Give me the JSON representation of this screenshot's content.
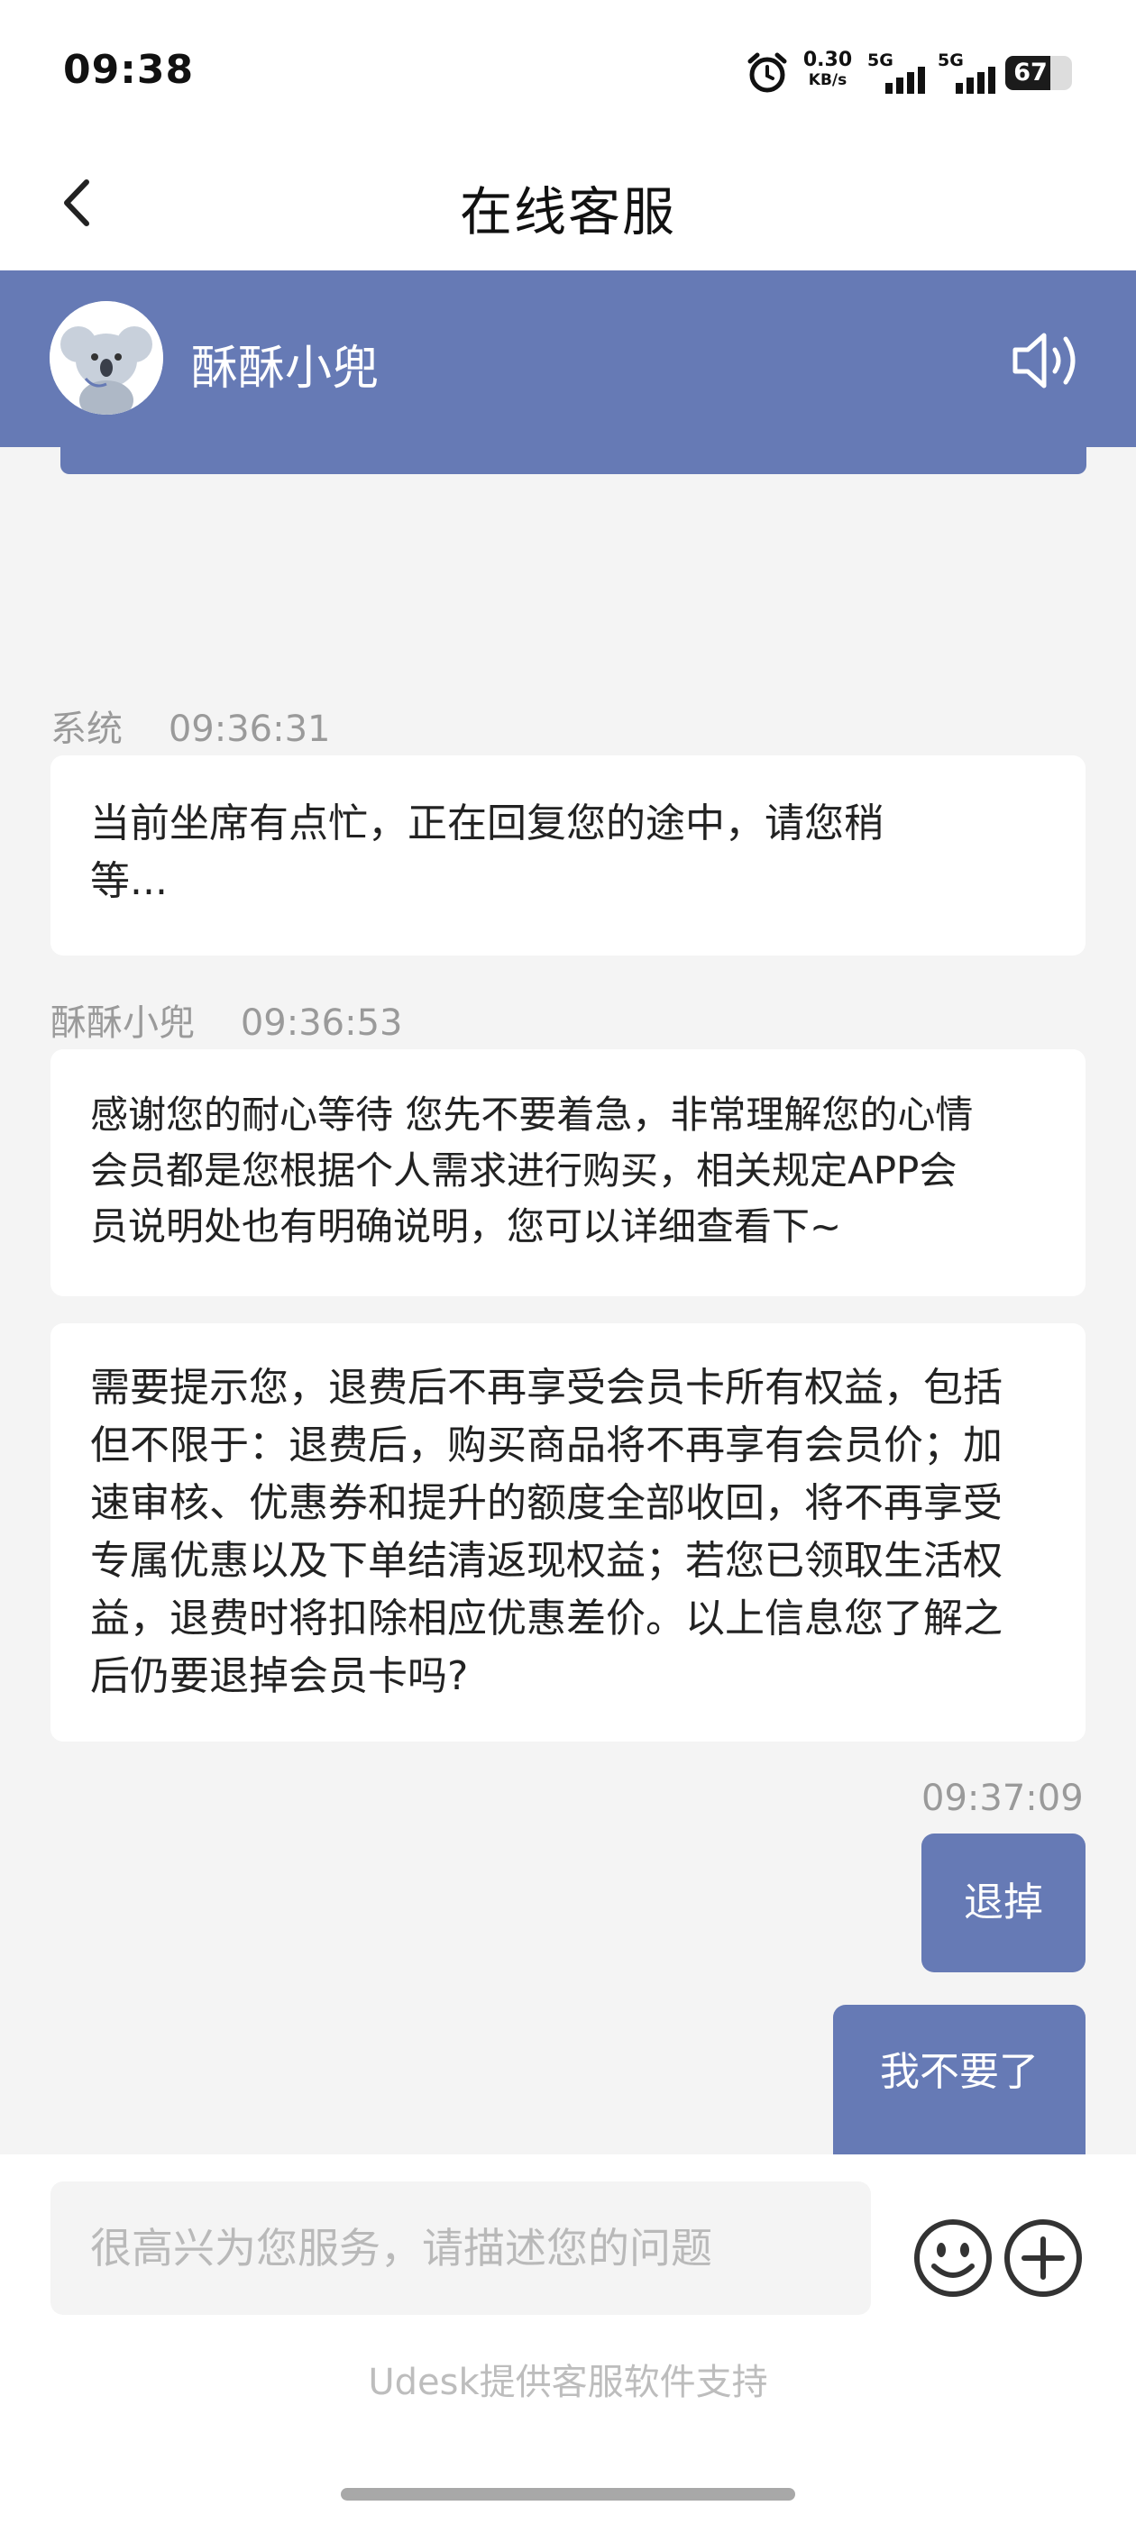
{
  "status_bar": {
    "time": "09:38",
    "net_speed_value": "0.30",
    "net_speed_unit": "KB/s",
    "sim1_label": "5G",
    "sim2_label": "5G",
    "battery_percent": "67"
  },
  "header": {
    "title": "在线客服"
  },
  "agent": {
    "name": "酥酥小兜"
  },
  "messages": [
    {
      "sender": "系统",
      "time": "09:36:31",
      "lines": [
        "当前坐席有点忙，正在回复您的途中，请您稍",
        "等..."
      ]
    },
    {
      "sender": "酥酥小兜",
      "time": "09:36:53",
      "lines": [
        "感谢您的耐心等待 您先不要着急，非常理解您的心情",
        "会员都是您根据个人需求进行购买，相关规定APP会",
        "员说明处也有明确说明，您可以详细查看下~"
      ]
    },
    {
      "lines": [
        "需要提示您，退费后不再享受会员卡所有权益，包括",
        "但不限于：退费后，购买商品将不再享有会员价；加",
        "速审核、优惠券和提升的额度全部收回，将不再享受",
        "专属优惠以及下单结清返现权益；若您已领取生活权",
        "益，退费时将扣除相应优惠差价。以上信息您了解之",
        "后仍要退掉会员卡吗?"
      ]
    }
  ],
  "user_messages": {
    "time": "09:37:09",
    "items": [
      "退掉",
      "我不要了"
    ]
  },
  "input": {
    "placeholder": "很高兴为您服务，请描述您的问题"
  },
  "footer": {
    "note": "Udesk提供客服软件支持"
  },
  "colors": {
    "accent": "#667ab5",
    "background": "#f4f4f4"
  },
  "icons": [
    "alarm-icon",
    "signal-icon",
    "battery-icon",
    "back-arrow-icon",
    "speaker-icon",
    "emoji-icon",
    "plus-icon",
    "koala-avatar"
  ]
}
